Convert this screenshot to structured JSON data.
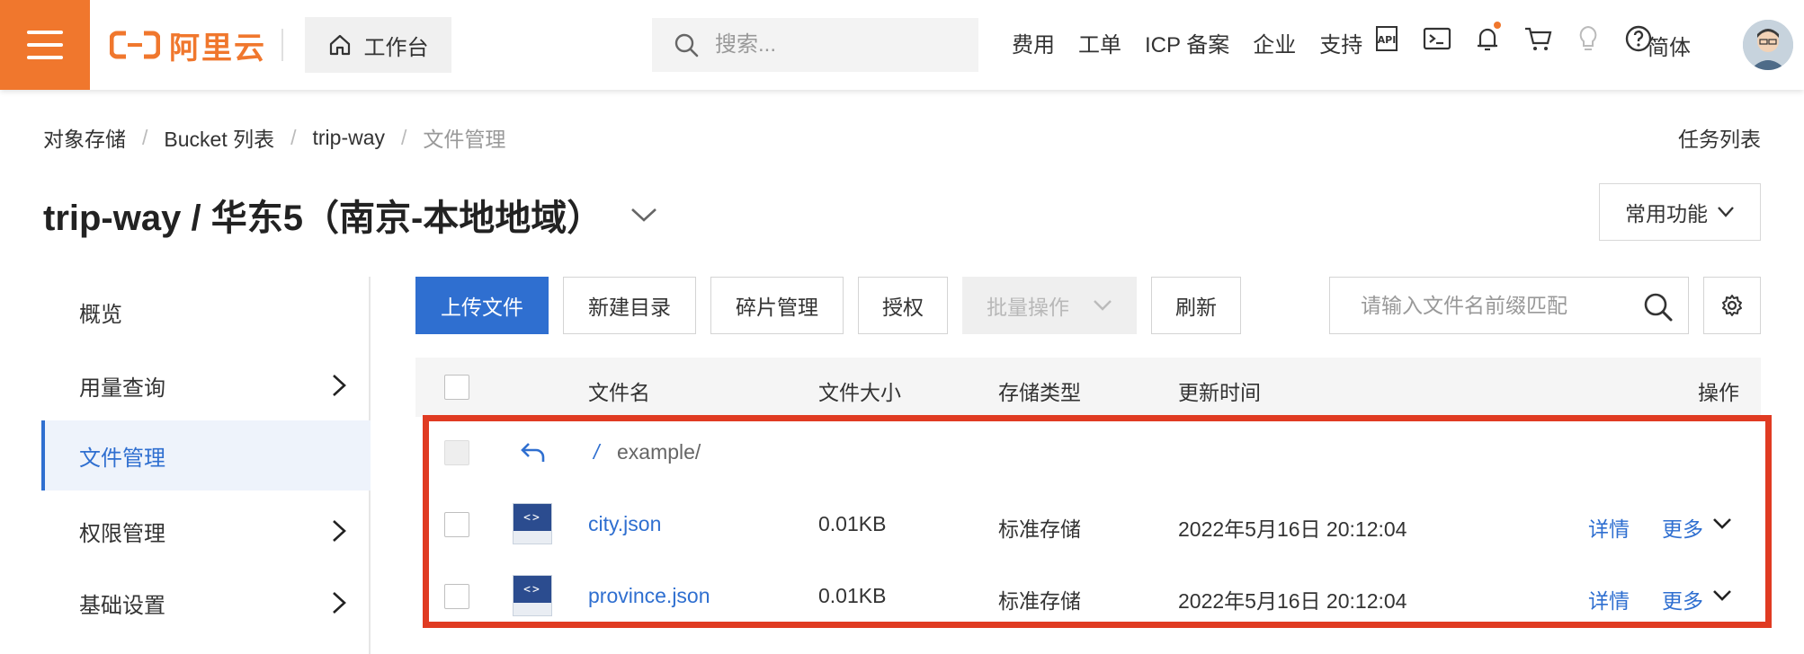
{
  "topbar": {
    "logo_text": "阿里云",
    "workbench_label": "工作台",
    "search_placeholder": "搜索...",
    "links": [
      "费用",
      "工单",
      "ICP 备案",
      "企业",
      "支持"
    ],
    "language": "简体",
    "accent_color": "#f0772d"
  },
  "breadcrumb": {
    "items": [
      "对象存储",
      "Bucket 列表",
      "trip-way"
    ],
    "current": "文件管理"
  },
  "task_list_label": "任务列表",
  "page_title": "trip-way / 华东5（南京-本地地域）",
  "common_functions_label": "常用功能",
  "sidenav": {
    "items": [
      {
        "label": "概览"
      },
      {
        "label": "用量查询"
      },
      {
        "label": "文件管理"
      },
      {
        "label": "权限管理"
      },
      {
        "label": "基础设置"
      }
    ],
    "active_color": "#2f6fd0"
  },
  "toolbar": {
    "upload": "上传文件",
    "new_dir": "新建目录",
    "fragments": "碎片管理",
    "authorize": "授权",
    "batch": "批量操作",
    "refresh": "刷新",
    "filter_placeholder": "请输入文件名前缀匹配"
  },
  "table": {
    "headers": {
      "name": "文件名",
      "size": "文件大小",
      "storage": "存储类型",
      "updated": "更新时间",
      "actions": "操作"
    },
    "back_row": {
      "root": "/",
      "path": "example/"
    },
    "rows": [
      {
        "name": "city.json",
        "size": "0.01KB",
        "storage": "标准存储",
        "updated": "2022年5月16日 20:12:04",
        "detail": "详情",
        "more": "更多"
      },
      {
        "name": "province.json",
        "size": "0.01KB",
        "storage": "标准存储",
        "updated": "2022年5月16日 20:12:04",
        "detail": "详情",
        "more": "更多"
      }
    ],
    "file_icon_text": "<>"
  }
}
